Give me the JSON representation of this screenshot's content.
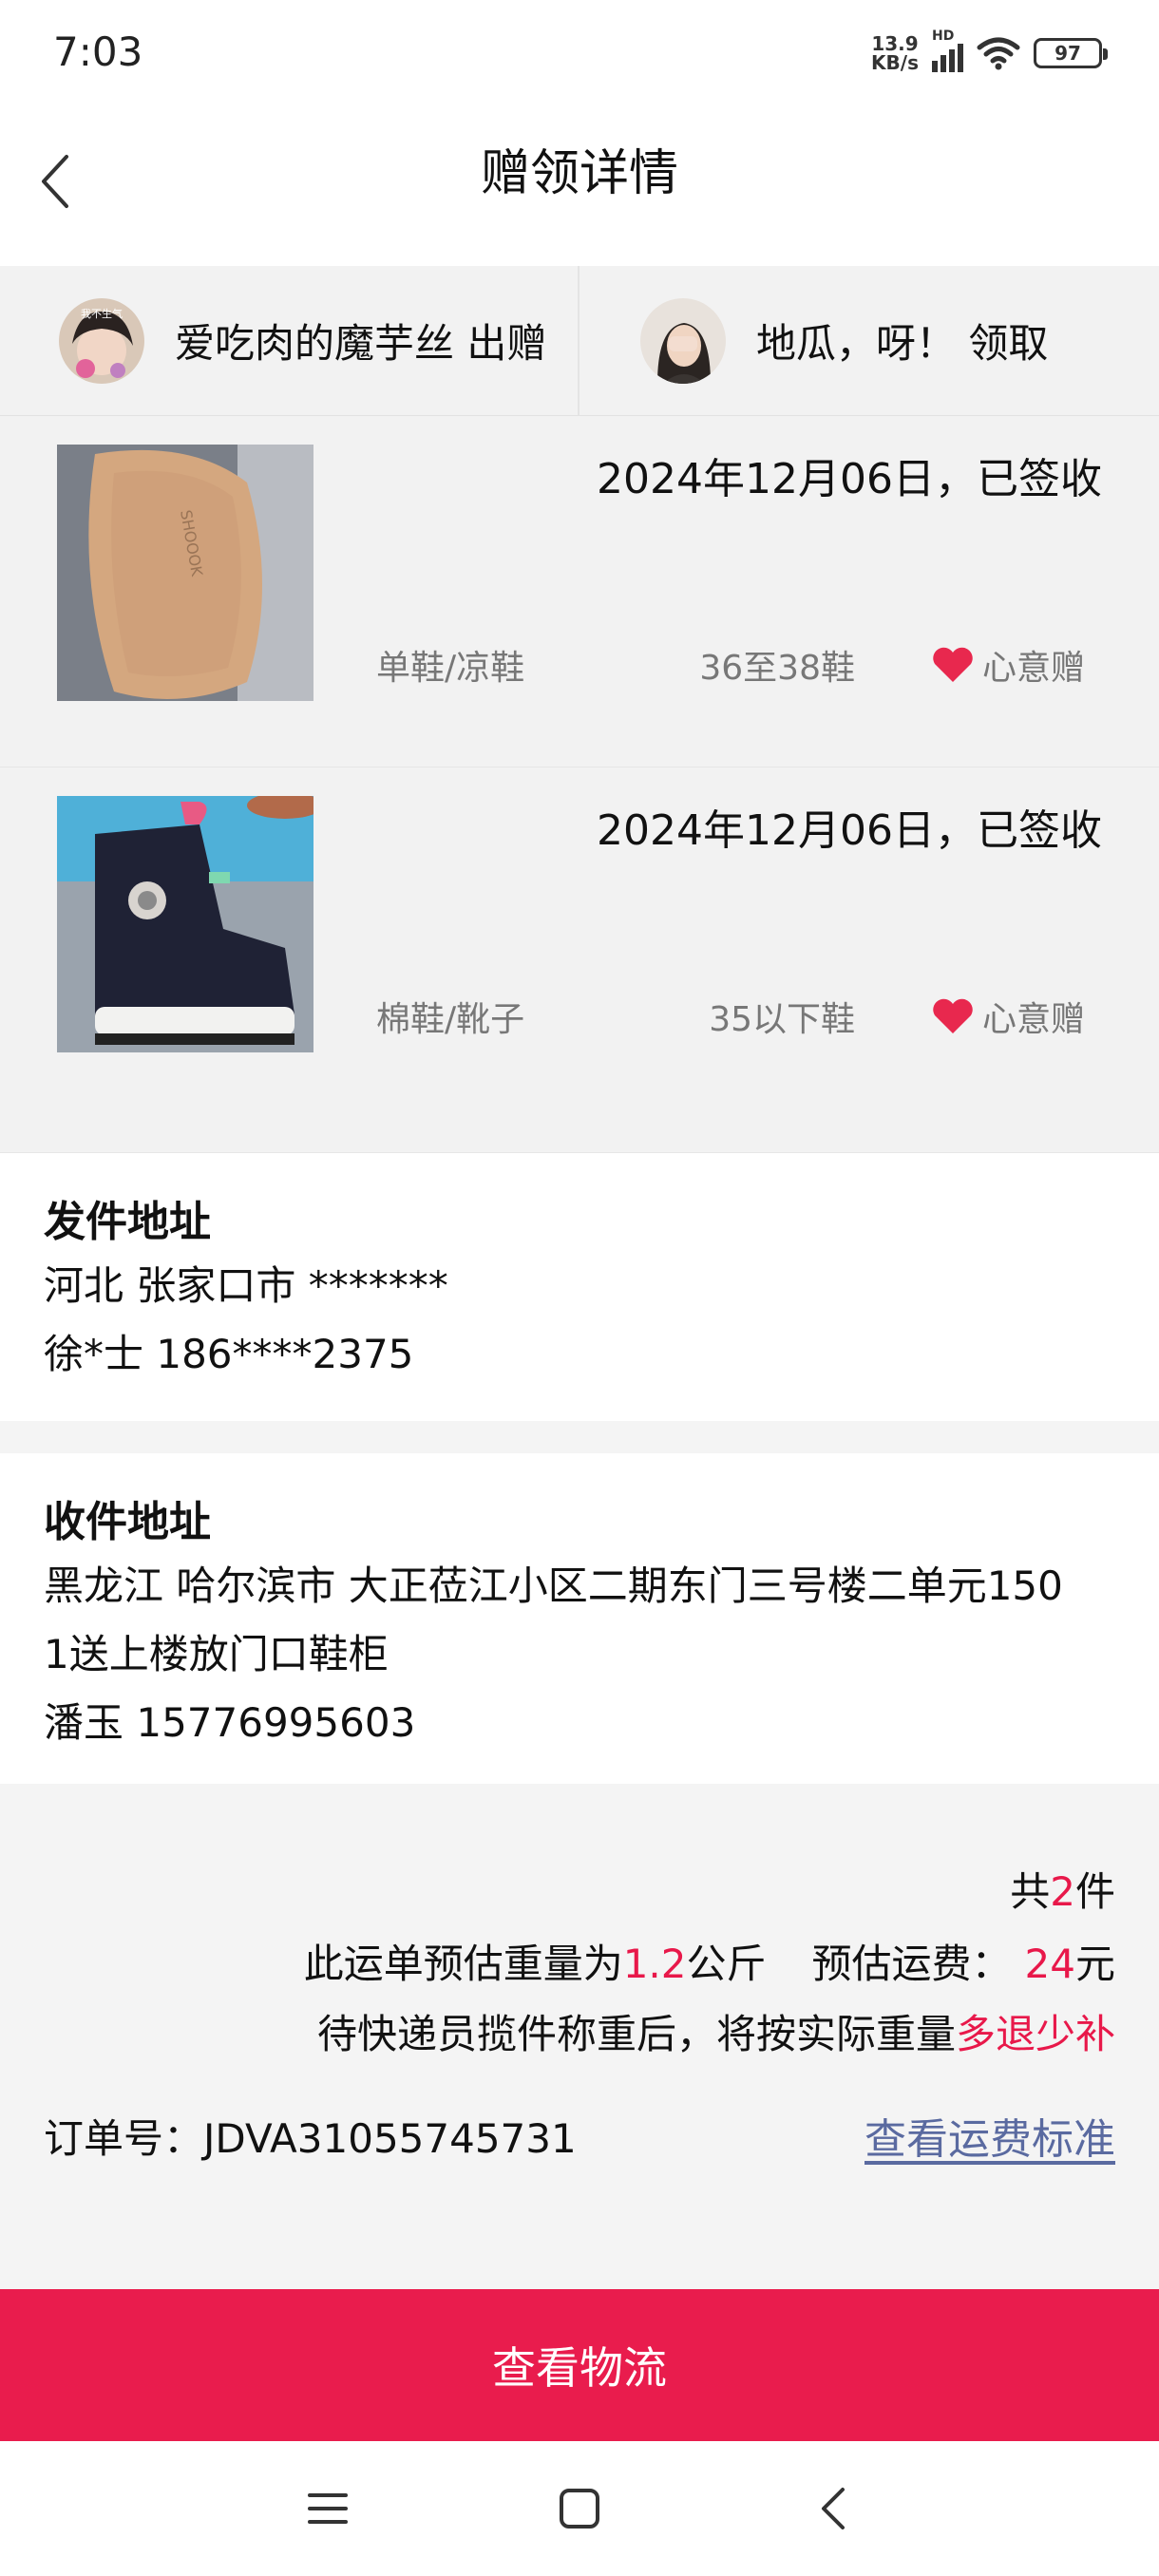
{
  "status": {
    "time": "7:03",
    "speed_value": "13.9",
    "speed_unit": "KB/s",
    "network": "HD",
    "battery": "97"
  },
  "header": {
    "title": "赠领详情"
  },
  "parties": {
    "giver": "爱吃肉的魔芋丝 出赠",
    "receiver": "地瓜，呀！ 领取",
    "giver_avatar_text": "我不生气"
  },
  "items": [
    {
      "date_status": "2024年12月06日，已签收",
      "category": "单鞋/凉鞋",
      "size": "36至38鞋",
      "tag": "心意赠",
      "photo_text": "SHOOOK"
    },
    {
      "date_status": "2024年12月06日，已签收",
      "category": "棉鞋/靴子",
      "size": "35以下鞋",
      "tag": "心意赠"
    }
  ],
  "sender": {
    "title": "发件地址",
    "address": "河北 张家口市 *******",
    "contact": "徐*士 186****2375"
  },
  "receiver_address": {
    "title": "收件地址",
    "address_line1": "黑龙江 哈尔滨市 大正莅江小区二期东门三号楼二单元150",
    "address_line2": "1送上楼放门口鞋柜",
    "contact": "潘玉 15776995603"
  },
  "summary": {
    "count_prefix": "共",
    "count": "2",
    "count_suffix": "件",
    "weight_prefix": "此运单预估重量为",
    "weight": "1.2",
    "weight_suffix": "公斤",
    "fee_prefix": "预估运费：",
    "fee": "24",
    "fee_suffix": "元",
    "note_prefix": "待快递员揽件称重后，将按实际重量",
    "note_accent": "多退少补",
    "order_label": "订单号：",
    "order_no": "JDVA31055745731",
    "fee_standard_link": "查看运费标准"
  },
  "actions": {
    "logistics_button": "查看物流"
  },
  "colors": {
    "accent": "#e8184a",
    "button": "#e91c4d",
    "link": "#5a6aa0",
    "heart": "#e8284e"
  }
}
